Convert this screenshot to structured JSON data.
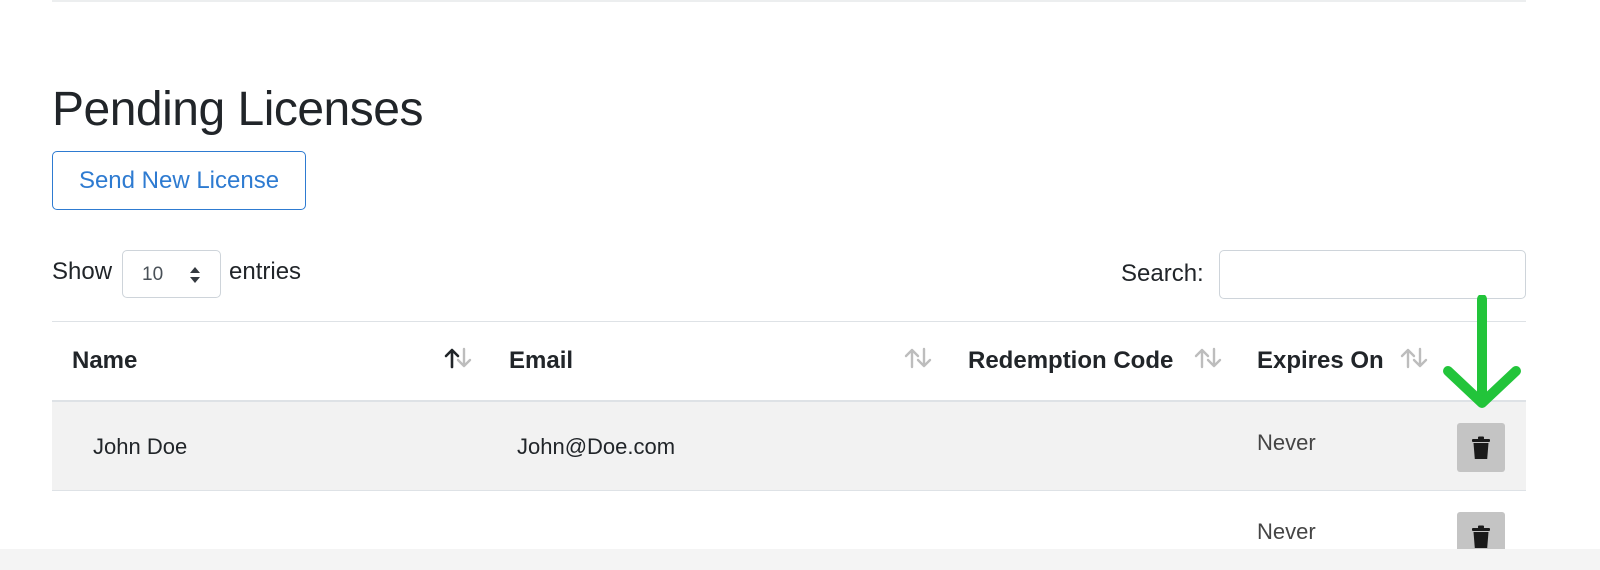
{
  "page": {
    "title": "Pending Licenses",
    "send_button_label": "Send New License"
  },
  "length_control": {
    "prefix": "Show",
    "selected": "10",
    "suffix": "entries"
  },
  "search": {
    "label": "Search:",
    "value": "",
    "placeholder": ""
  },
  "table": {
    "columns": [
      {
        "label": "Name",
        "sort": "ascending"
      },
      {
        "label": "Email",
        "sort": "none"
      },
      {
        "label": "Redemption Code",
        "sort": "none"
      },
      {
        "label": "Expires On",
        "sort": "none"
      }
    ],
    "rows": [
      {
        "name": "John Doe",
        "email": "John@Doe.com",
        "redemption_code": "",
        "expires_on": "Never"
      },
      {
        "name": "",
        "email": "",
        "redemption_code": "",
        "expires_on": "Never"
      }
    ]
  },
  "icons": {
    "sort": "sort-arrows-icon",
    "delete": "trash-icon",
    "annotation": "down-arrow-icon"
  },
  "colors": {
    "primary": "#2e7bd1",
    "highlight_arrow": "#22c43a",
    "delete_button": "#c4c4c4",
    "striped_row": "#f2f2f2"
  }
}
